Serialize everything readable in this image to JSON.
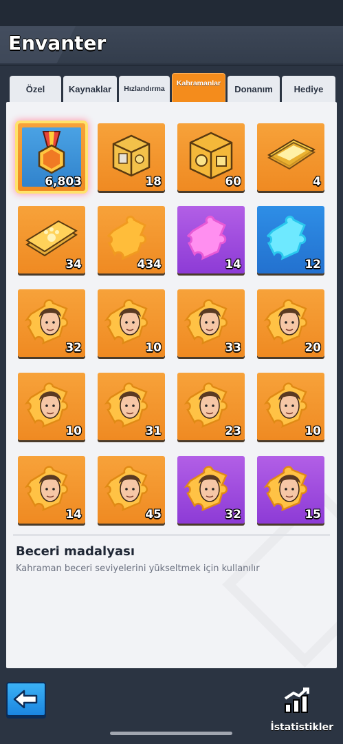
{
  "header": {
    "title": "Envanter"
  },
  "tabs": [
    {
      "label": "Özel"
    },
    {
      "label": "Kaynaklar"
    },
    {
      "label": "Hızlandırma"
    },
    {
      "label": "Kahramanlar"
    },
    {
      "label": "Donanım"
    },
    {
      "label": "Hediye"
    }
  ],
  "active_tab": "Kahramanlar",
  "items": [
    {
      "icon": "skill-medal-icon",
      "count": "6,803",
      "color": "orange",
      "selected": true
    },
    {
      "icon": "silver-chest-icon",
      "count": "18",
      "color": "orange"
    },
    {
      "icon": "gold-chest-icon",
      "count": "60",
      "color": "orange"
    },
    {
      "icon": "gold-ticket-icon",
      "count": "4",
      "color": "orange"
    },
    {
      "icon": "paw-ticket-icon",
      "count": "34",
      "color": "orange"
    },
    {
      "icon": "orange-puzzle-icon",
      "count": "434",
      "color": "orange"
    },
    {
      "icon": "pink-puzzle-icon",
      "count": "14",
      "color": "purple"
    },
    {
      "icon": "cyan-puzzle-icon",
      "count": "12",
      "color": "blue"
    },
    {
      "icon": "hero-shard-icon",
      "count": "32",
      "color": "orange"
    },
    {
      "icon": "hero-shard-icon",
      "count": "10",
      "color": "orange"
    },
    {
      "icon": "hero-shard-icon",
      "count": "33",
      "color": "orange"
    },
    {
      "icon": "hero-shard-icon",
      "count": "20",
      "color": "orange"
    },
    {
      "icon": "hero-shard-icon",
      "count": "10",
      "color": "orange"
    },
    {
      "icon": "hero-shard-icon",
      "count": "31",
      "color": "orange"
    },
    {
      "icon": "hero-shard-icon",
      "count": "23",
      "color": "orange"
    },
    {
      "icon": "hero-shard-icon",
      "count": "10",
      "color": "orange"
    },
    {
      "icon": "hero-shard-icon",
      "count": "14",
      "color": "orange"
    },
    {
      "icon": "hero-shard-icon",
      "count": "45",
      "color": "orange"
    },
    {
      "icon": "hero-shard-icon",
      "count": "32",
      "color": "purple"
    },
    {
      "icon": "hero-shard-icon",
      "count": "15",
      "color": "purple"
    }
  ],
  "description": {
    "title": "Beceri madalyası",
    "text": "Kahraman beceri seviyelerini yükseltmek için kullanılır"
  },
  "footer": {
    "stats_label": "İstatistikler"
  },
  "colors": {
    "orange": "#f48c1c",
    "purple": "#9c48dd",
    "blue": "#2a82dc",
    "selected_glow": "#ffe36b"
  }
}
